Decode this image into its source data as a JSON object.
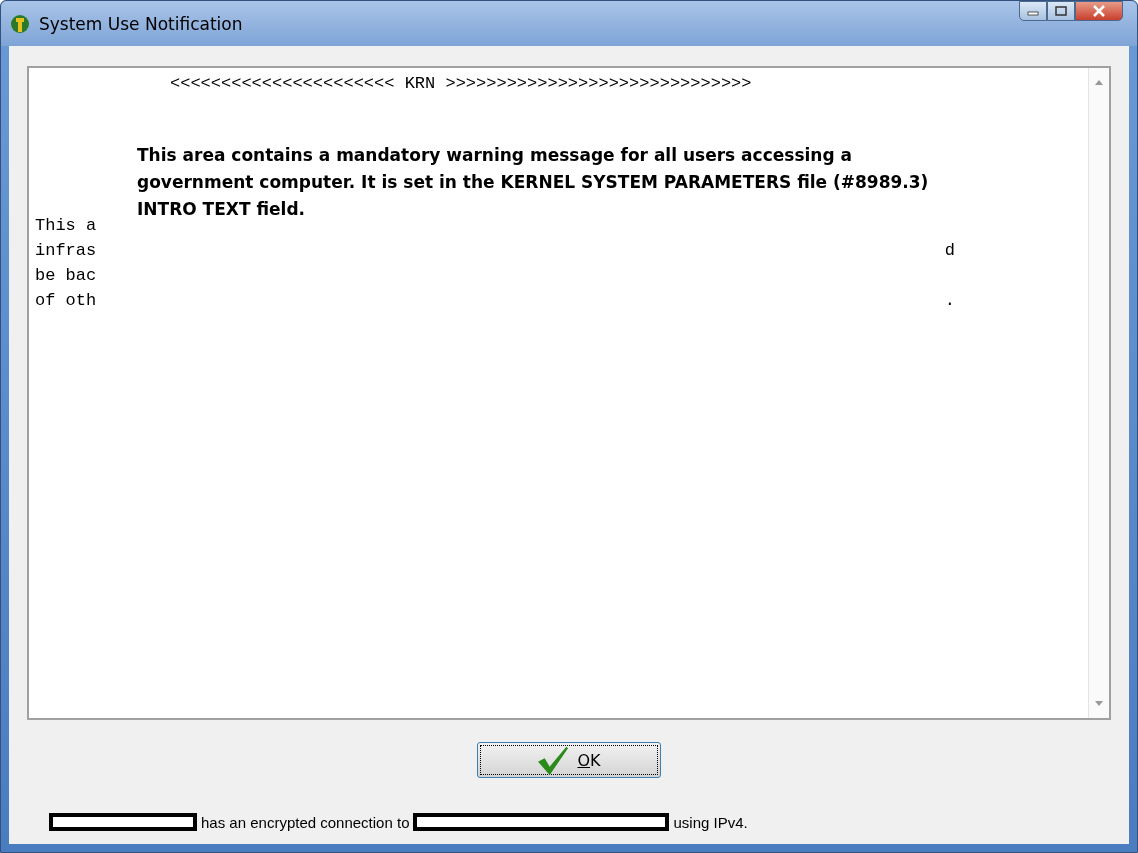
{
  "window": {
    "title": "System Use Notification"
  },
  "message": {
    "banner": "<<<<<<<<<<<<<<<<<<<<<< KRN >>>>>>>>>>>>>>>>>>>>>>>>>>>>>>",
    "fragments": [
      {
        "left": "This a"
      },
      {
        "left": "infras",
        "right": "d"
      },
      {
        "left": "be bac"
      },
      {
        "left": "of oth",
        "right": "."
      }
    ]
  },
  "annotation": {
    "text": "This area contains a mandatory warning message for all users accessing a government computer. It is set in the KERNEL SYSTEM PARAMETERS file (#8989.3) INTRO TEXT field."
  },
  "ok_button": {
    "label": "OK"
  },
  "status_bar": {
    "parts": [
      {
        "kind": "redacted"
      },
      {
        "kind": "text",
        "text": "has an encrypted connection to"
      },
      {
        "kind": "redacted"
      },
      {
        "kind": "text",
        "text": "using IPv4."
      }
    ]
  }
}
